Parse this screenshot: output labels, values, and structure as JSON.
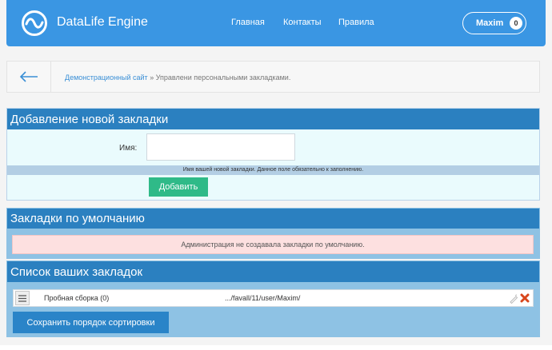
{
  "header": {
    "brand": "DataLife Engine",
    "nav": [
      "Главная",
      "Контакты",
      "Правила"
    ],
    "user": {
      "name": "Maxim",
      "count": "0"
    }
  },
  "breadcrumb": {
    "link": "Демонстрационный сайт",
    "separator": " » ",
    "current": "Управлени персональными закладками."
  },
  "add_panel": {
    "title": "Добавление новой закладки",
    "name_label": "Имя:",
    "name_value": "",
    "hint": "Имя вашей новой закладки. Данное поле обязательно к заполнению.",
    "add_button": "Добавить"
  },
  "default_panel": {
    "title": "Закладки по умолчанию",
    "notice": "Администрация не создавала закладки по умолчанию."
  },
  "list_panel": {
    "title": "Список ваших закладок",
    "items": [
      {
        "name": "Пробная сборка (0)",
        "url": ".../favall/11/user/Maxim/"
      }
    ],
    "save_button": "Сохранить порядок сортировки"
  },
  "colors": {
    "header": "#3a96e3",
    "panel_title": "#2b80c0",
    "add_button": "#2fba88",
    "save_button": "#2a84c8",
    "notice_bg": "#fde0e0"
  },
  "icons": [
    "logo-icon",
    "back-arrow-icon",
    "drag-handle-icon",
    "edit-icon",
    "delete-icon"
  ]
}
